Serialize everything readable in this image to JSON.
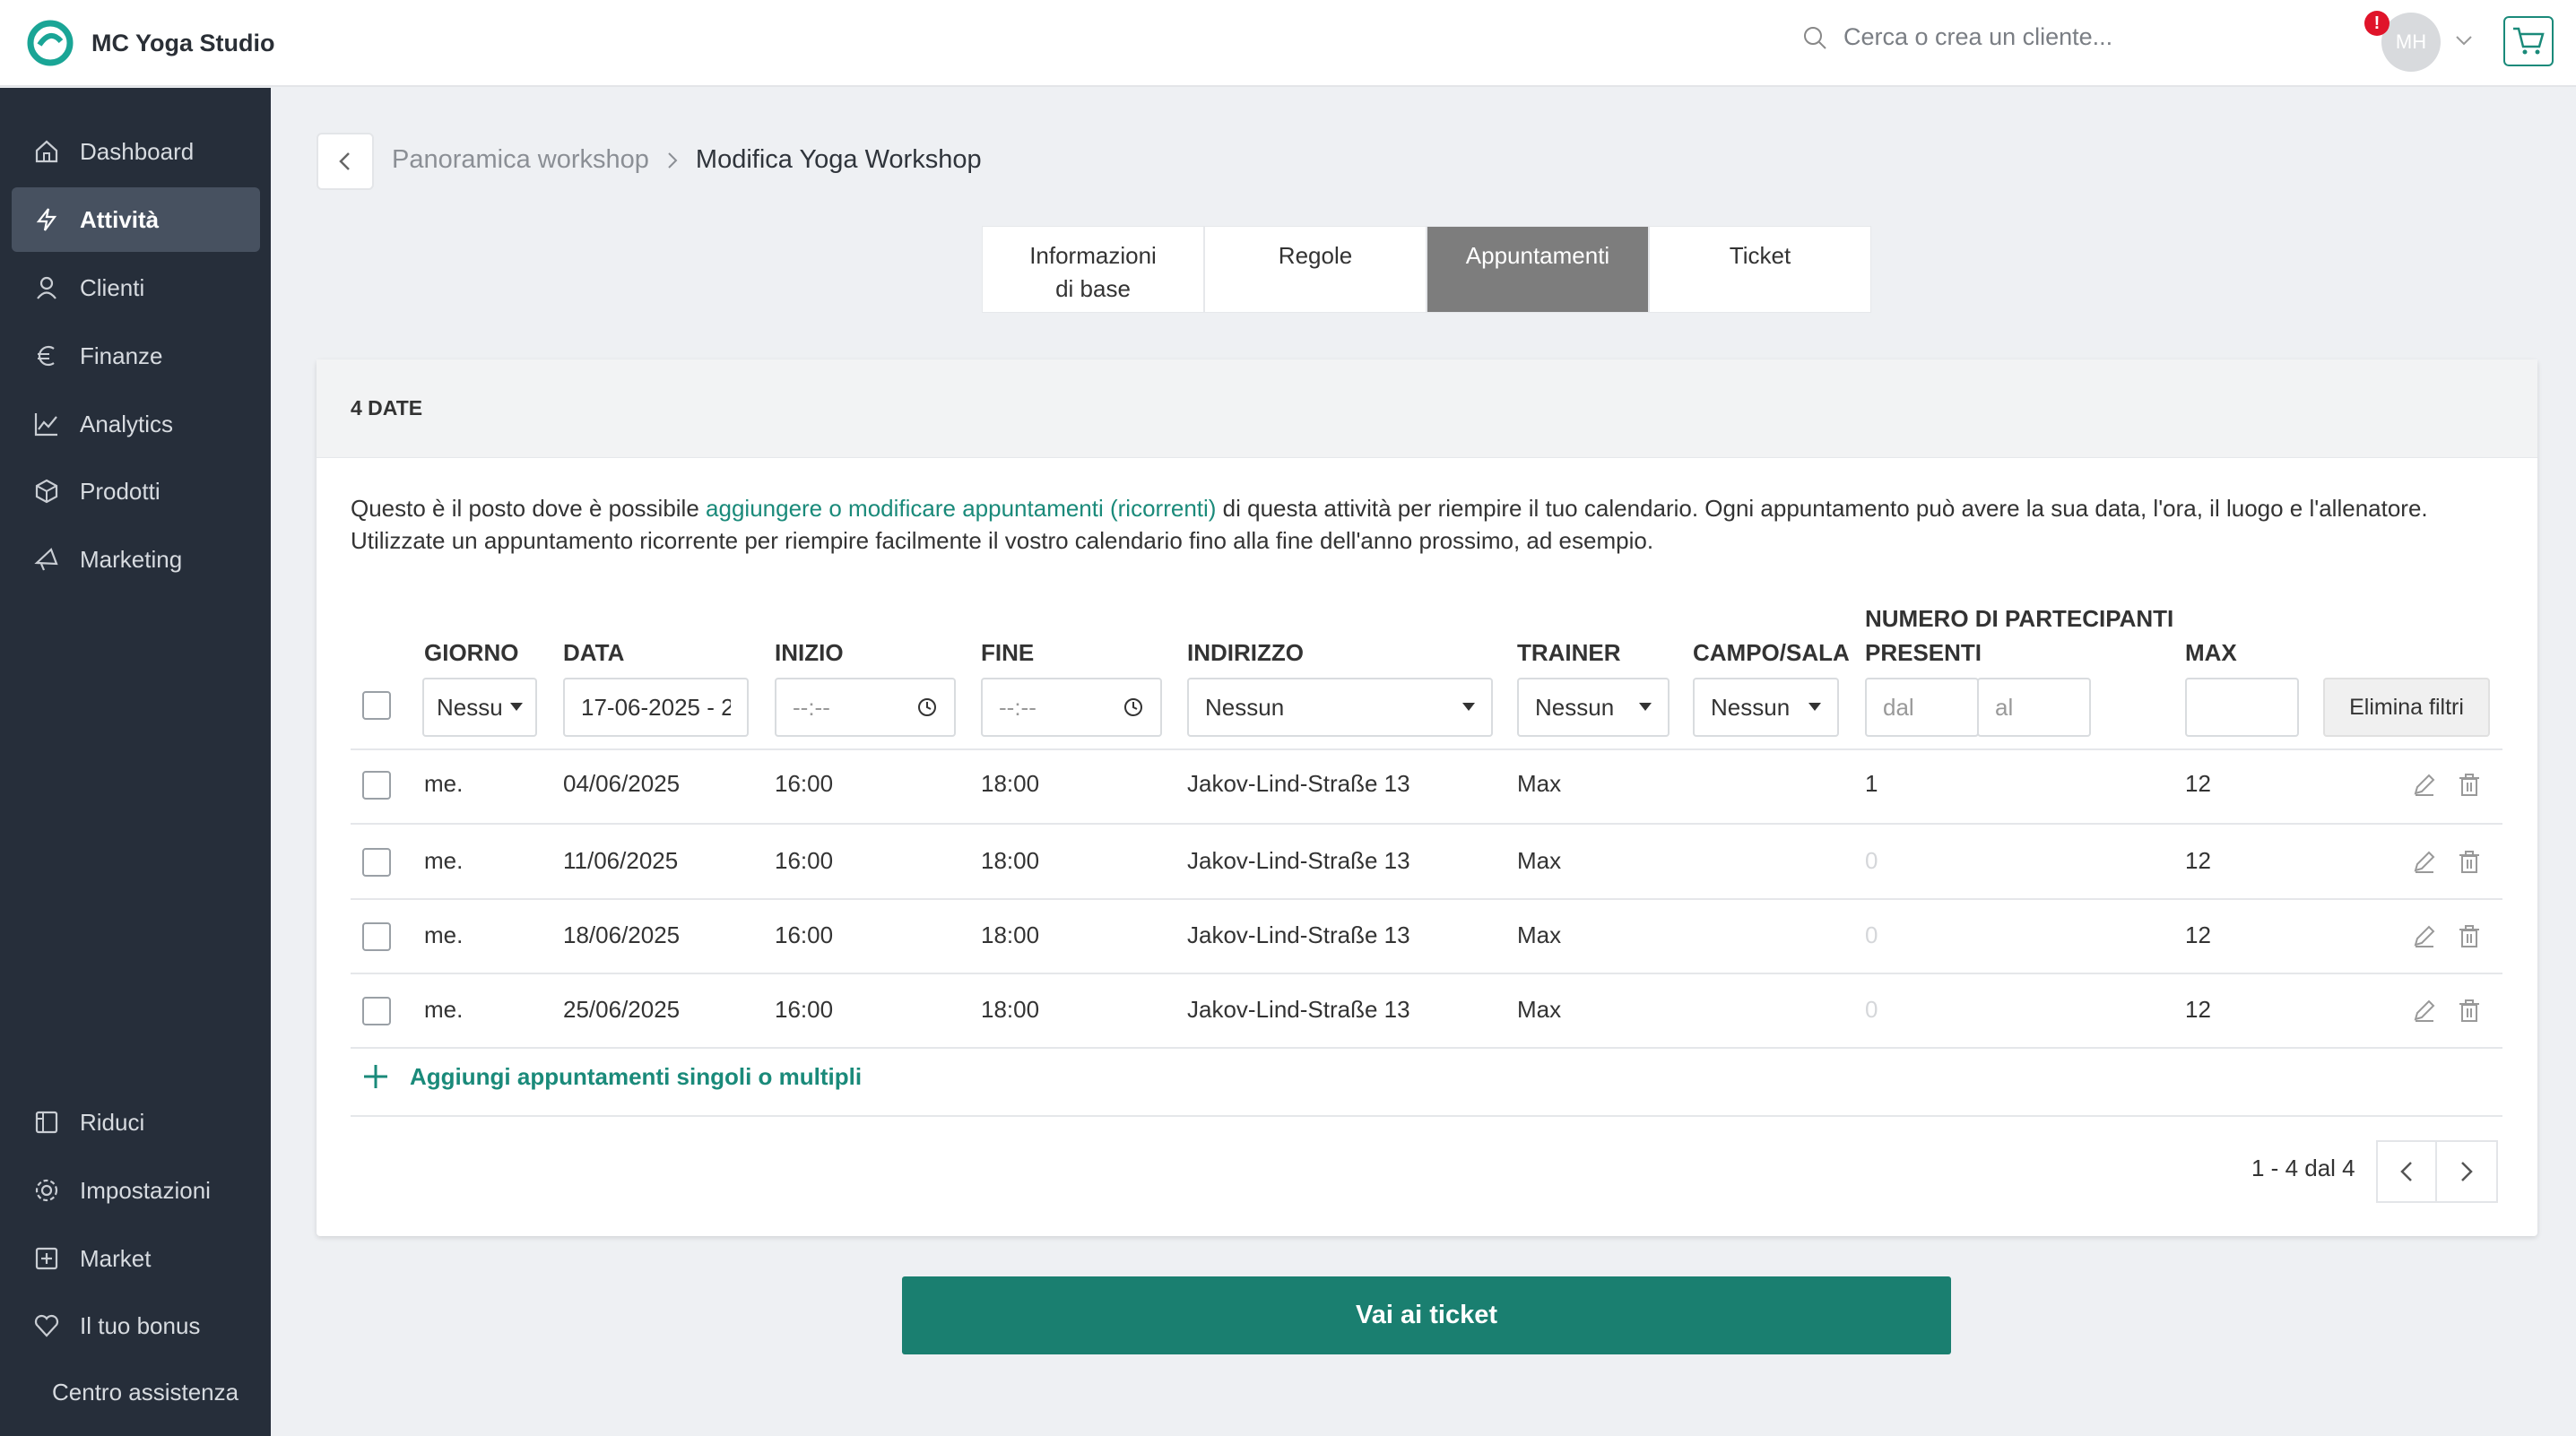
{
  "app": {
    "title": "MC Yoga Studio"
  },
  "header": {
    "search_placeholder": "Cerca o crea un cliente...",
    "avatar_initials": "MH",
    "alert_mark": "!"
  },
  "sidebar": {
    "items": [
      {
        "label": "Dashboard",
        "icon": "home-icon"
      },
      {
        "label": "Attività",
        "icon": "lightning-icon",
        "active": true
      },
      {
        "label": "Clienti",
        "icon": "user-icon"
      },
      {
        "label": "Finanze",
        "icon": "euro-icon"
      },
      {
        "label": "Analytics",
        "icon": "chart-icon"
      },
      {
        "label": "Prodotti",
        "icon": "box-icon"
      },
      {
        "label": "Marketing",
        "icon": "megaphone-icon"
      }
    ],
    "bottom_items": [
      {
        "label": "Riduci",
        "icon": "collapse-icon"
      },
      {
        "label": "Impostazioni",
        "icon": "gear-icon"
      },
      {
        "label": "Market",
        "icon": "plus-square-icon"
      },
      {
        "label": "Il tuo bonus",
        "icon": "heart-icon"
      }
    ],
    "help": "Centro assistenza"
  },
  "breadcrumb": {
    "parent": "Panoramica workshop",
    "current": "Modifica Yoga Workshop"
  },
  "tabs": [
    {
      "label": "Informazioni di base"
    },
    {
      "label": "Regole"
    },
    {
      "label": "Appuntamenti",
      "active": true
    },
    {
      "label": "Ticket"
    }
  ],
  "card": {
    "title": "4 DATE",
    "desc_before": "Questo è il posto dove è possibile ",
    "desc_link": "aggiungere o modificare appuntamenti (ricorrenti)",
    "desc_after": " di questa attività per riempire il tuo calendario. Ogni appuntamento può avere la sua data, l'ora, il luogo e l'allenatore. Utilizzate un appuntamento ricorrente per riempire facilmente il vostro calendario fino alla fine dell'anno prossimo, ad esempio."
  },
  "table": {
    "headers": {
      "giorno": "GIORNO",
      "data": "DATA",
      "inizio": "INIZIO",
      "fine": "FINE",
      "indirizzo": "INDIRIZZO",
      "trainer": "TRAINER",
      "campo": "CAMPO/SALA",
      "partecipanti_1": "NUMERO DI PARTECIPANTI",
      "partecipanti_2": "PRESENTI",
      "max": "MAX"
    },
    "filters": {
      "giorno": "Nessun",
      "data": "17-06-2025 - 2",
      "inizio": "--:--",
      "fine": "--:--",
      "indirizzo": "Nessun",
      "trainer": "Nessun",
      "campo": "Nessun",
      "dal_placeholder": "dal",
      "al_placeholder": "al",
      "max": "",
      "clear": "Elimina filtri"
    },
    "rows": [
      {
        "giorno": "me.",
        "data": "04/06/2025",
        "inizio": "16:00",
        "fine": "18:00",
        "indirizzo": "Jakov-Lind-Straße 13",
        "trainer": "Max",
        "presenti": "1",
        "max": "12"
      },
      {
        "giorno": "me.",
        "data": "11/06/2025",
        "inizio": "16:00",
        "fine": "18:00",
        "indirizzo": "Jakov-Lind-Straße 13",
        "trainer": "Max",
        "presenti": "0",
        "max": "12"
      },
      {
        "giorno": "me.",
        "data": "18/06/2025",
        "inizio": "16:00",
        "fine": "18:00",
        "indirizzo": "Jakov-Lind-Straße 13",
        "trainer": "Max",
        "presenti": "0",
        "max": "12"
      },
      {
        "giorno": "me.",
        "data": "25/06/2025",
        "inizio": "16:00",
        "fine": "18:00",
        "indirizzo": "Jakov-Lind-Straße 13",
        "trainer": "Max",
        "presenti": "0",
        "max": "12"
      }
    ],
    "add_label": "Aggiungi appuntamenti singoli o multipli",
    "pagination": "1 - 4 dal 4"
  },
  "cta": {
    "label": "Vai ai ticket"
  },
  "colors": {
    "accent": "#1a7f70",
    "sidebar": "#262e3a",
    "active_tab": "#7d7d7d"
  }
}
